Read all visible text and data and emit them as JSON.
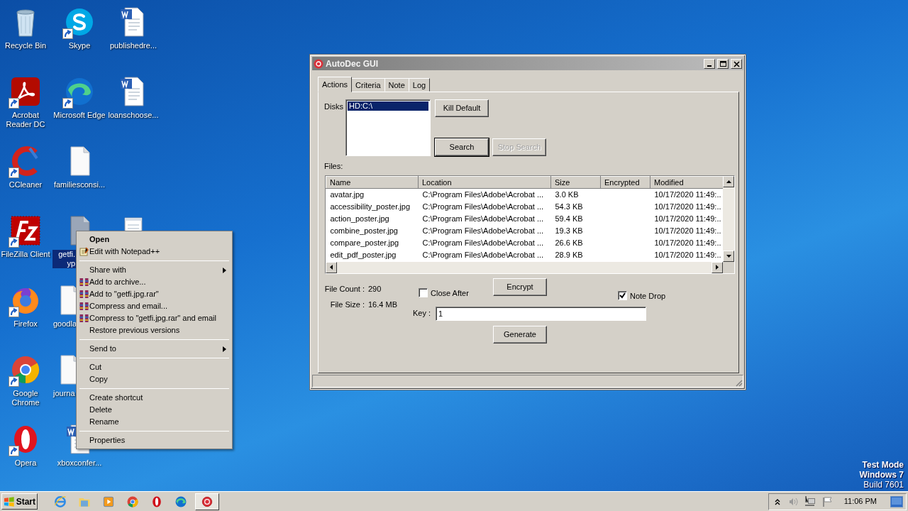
{
  "desktop_icons": [
    {
      "kind": "recycle-bin",
      "label": "Recycle Bin",
      "shortcut": false,
      "selected": false
    },
    {
      "kind": "skype",
      "label": "Skype",
      "shortcut": true,
      "selected": false
    },
    {
      "kind": "word-doc",
      "label": "publishedre...",
      "shortcut": false,
      "selected": false
    },
    {
      "kind": "acrobat",
      "label": "Acrobat Reader DC",
      "shortcut": true,
      "selected": false
    },
    {
      "kind": "edge",
      "label": "Microsoft Edge",
      "shortcut": true,
      "selected": false
    },
    {
      "kind": "word-doc",
      "label": "loanschoose...",
      "shortcut": false,
      "selected": false
    },
    {
      "kind": "ccleaner",
      "label": "CCleaner",
      "shortcut": true,
      "selected": false
    },
    {
      "kind": "blank-doc",
      "label": "familiesconsi...",
      "shortcut": false,
      "selected": false
    },
    {
      "kind": "filezilla",
      "label": "FileZilla Client",
      "shortcut": true,
      "selected": false
    },
    {
      "kind": "image-file",
      "label": "getfi.\nyp",
      "shortcut": false,
      "selected": true
    },
    {
      "kind": "notepad-doc",
      "shortcut": false,
      "selected": false
    },
    {
      "kind": "firefox",
      "label": "Firefox",
      "shortcut": true,
      "selected": false
    },
    {
      "kind": "blank-doc",
      "label": "goodla",
      "shortcut": false,
      "selected": false
    },
    {
      "kind": "chrome",
      "label": "Google Chrome",
      "shortcut": true,
      "selected": false
    },
    {
      "kind": "blank-doc",
      "label": "journa",
      "shortcut": false,
      "selected": false
    },
    {
      "kind": "opera",
      "label": "Opera",
      "shortcut": true,
      "selected": false
    },
    {
      "kind": "word-doc",
      "label": "xboxconfer...",
      "shortcut": false,
      "selected": false
    }
  ],
  "context_menu": {
    "items": [
      {
        "kind": "item",
        "label": "Open",
        "default": true
      },
      {
        "kind": "notepad-item",
        "label": "Edit with Notepad++"
      },
      {
        "kind": "separator"
      },
      {
        "kind": "item",
        "label": "Share with",
        "submenu": true
      },
      {
        "kind": "archive-item",
        "label": "Add to archive..."
      },
      {
        "kind": "archive-item",
        "label": "Add to \"getfi.jpg.rar\""
      },
      {
        "kind": "archive-item",
        "label": "Compress and email..."
      },
      {
        "kind": "archive-item",
        "label": "Compress to \"getfi.jpg.rar\" and email"
      },
      {
        "kind": "item",
        "label": "Restore previous versions"
      },
      {
        "kind": "separator"
      },
      {
        "kind": "item",
        "label": "Send to",
        "submenu": true
      },
      {
        "kind": "separator"
      },
      {
        "kind": "item",
        "label": "Cut"
      },
      {
        "kind": "item",
        "label": "Copy"
      },
      {
        "kind": "separator"
      },
      {
        "kind": "item",
        "label": "Create shortcut"
      },
      {
        "kind": "item",
        "label": "Delete"
      },
      {
        "kind": "item",
        "label": "Rename"
      },
      {
        "kind": "separator"
      },
      {
        "kind": "item",
        "label": "Properties"
      }
    ]
  },
  "window": {
    "title": "AutoDec GUI",
    "tabs": [
      {
        "label": "Actions",
        "selected": true
      },
      {
        "label": "Criteria",
        "selected": false
      },
      {
        "label": "Note",
        "selected": false
      },
      {
        "label": "Log",
        "selected": false
      }
    ],
    "disks": {
      "label": "Disks",
      "items": [
        {
          "text": "HD:C:\\",
          "selected": true
        }
      ]
    },
    "kill_default_button": {
      "label": "Kill Default",
      "disabled": false
    },
    "search_button": {
      "label": "Search",
      "disabled": false,
      "default": true
    },
    "stop_search_button": {
      "label": "Stop Search",
      "disabled": true
    },
    "files": {
      "label": "Files:",
      "columns": [
        "Name",
        "Location",
        "Size",
        "Encrypted",
        "Modified"
      ],
      "rows": [
        {
          "name": "avatar.jpg",
          "location": "C:\\Program Files\\Adobe\\Acrobat ...",
          "size": "3.0 KB",
          "modified": "10/17/2020 11:49:.."
        },
        {
          "name": "accessibility_poster.jpg",
          "location": "C:\\Program Files\\Adobe\\Acrobat ...",
          "size": "54.3 KB",
          "modified": "10/17/2020 11:49:.."
        },
        {
          "name": "action_poster.jpg",
          "location": "C:\\Program Files\\Adobe\\Acrobat ...",
          "size": "59.4 KB",
          "modified": "10/17/2020 11:49:.."
        },
        {
          "name": "combine_poster.jpg",
          "location": "C:\\Program Files\\Adobe\\Acrobat ...",
          "size": "19.3 KB",
          "modified": "10/17/2020 11:49:.."
        },
        {
          "name": "compare_poster.jpg",
          "location": "C:\\Program Files\\Adobe\\Acrobat ...",
          "size": "26.6 KB",
          "modified": "10/17/2020 11:49:.."
        },
        {
          "name": "edit_pdf_poster.jpg",
          "location": "C:\\Program Files\\Adobe\\Acrobat ...",
          "size": "28.9 KB",
          "modified": "10/17/2020 11:49:.."
        }
      ]
    },
    "file_count": {
      "label": "File Count :",
      "value": "290"
    },
    "file_size": {
      "label": "File Size :",
      "value": "16.4 MB"
    },
    "close_after": {
      "label": "Close After",
      "checked": false
    },
    "encrypt_button": {
      "label": "Encrypt"
    },
    "note_drop": {
      "label": "Note Drop",
      "checked": true
    },
    "key": {
      "label": "Key :",
      "value": "1"
    },
    "generate_button": {
      "label": "Generate"
    }
  },
  "os_notice": {
    "mode": "Test Mode",
    "os": "Windows 7",
    "build": "Build 7601"
  },
  "taskbar": {
    "start_label": "Start",
    "apps": [
      {
        "kind": "ie",
        "active": false
      },
      {
        "kind": "explorer",
        "active": false
      },
      {
        "kind": "media-player",
        "active": false
      },
      {
        "kind": "chrome",
        "active": false
      },
      {
        "kind": "opera",
        "active": false
      },
      {
        "kind": "edge",
        "active": false
      },
      {
        "kind": "autodec",
        "active": true
      }
    ],
    "clock": "11:06 PM"
  }
}
